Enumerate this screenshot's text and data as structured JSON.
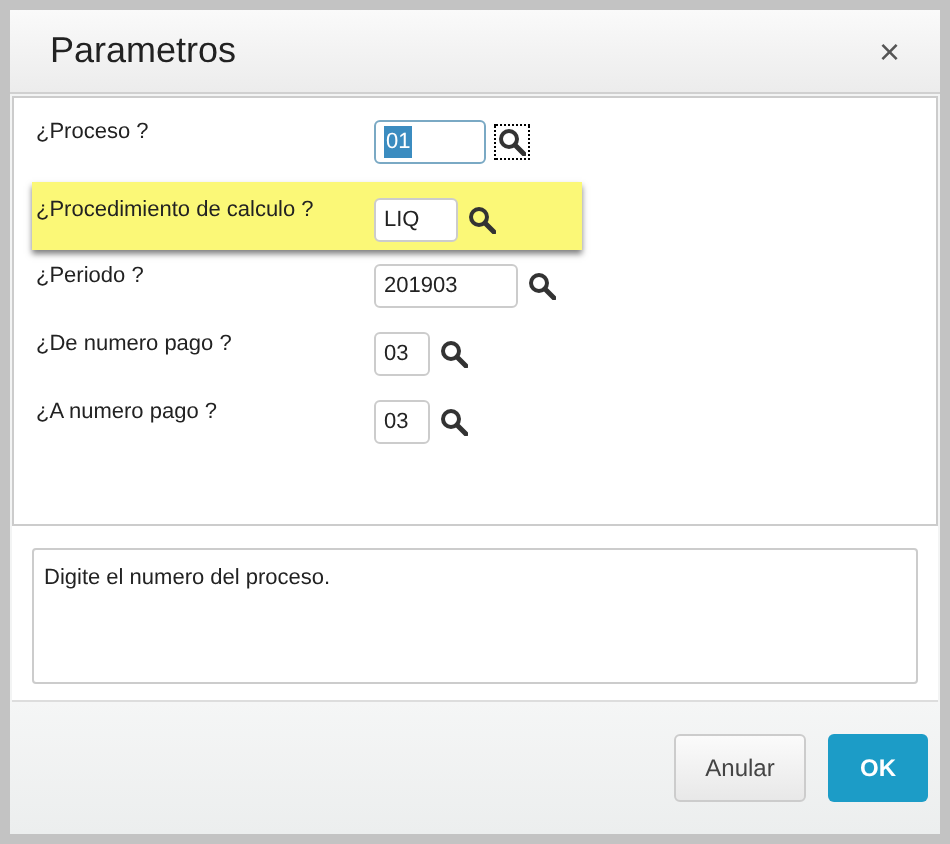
{
  "dialog": {
    "title": "Parametros",
    "close": "×"
  },
  "parameters": [
    {
      "label": "¿Proceso ?",
      "value": "01",
      "highlighted": false,
      "focused": true
    },
    {
      "label": "¿Procedimiento de calculo ?",
      "value": "LIQ",
      "highlighted": true,
      "focused": false
    },
    {
      "label": "¿Periodo ?",
      "value": "201903",
      "highlighted": false,
      "focused": false
    },
    {
      "label": "¿De numero pago ?",
      "value": "03",
      "highlighted": false,
      "focused": false
    },
    {
      "label": "¿A numero pago ?",
      "value": "03",
      "highlighted": false,
      "focused": false
    }
  ],
  "help_text": "Digite el numero del proceso.",
  "buttons": [
    {
      "label": "Anular",
      "kind": "secondary"
    },
    {
      "label": "OK",
      "kind": "primary"
    }
  ]
}
